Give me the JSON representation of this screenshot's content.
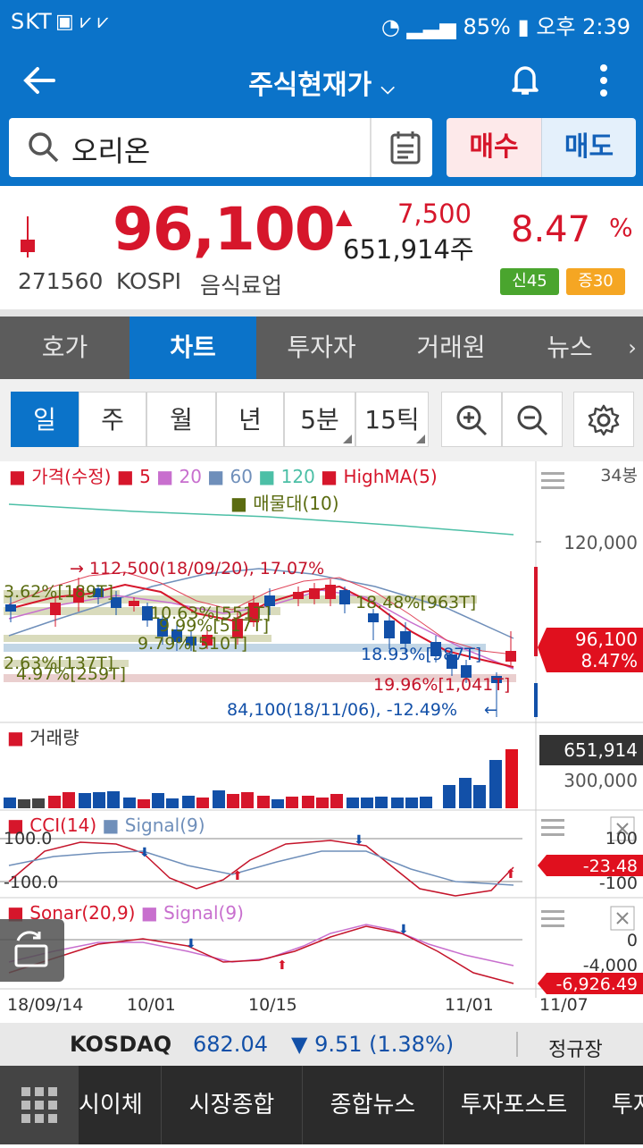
{
  "status_bar": {
    "carrier": "SKT",
    "battery": "85%",
    "time": "오후 2:39"
  },
  "app_bar": {
    "title": "주식현재가"
  },
  "search": {
    "value": "오리온"
  },
  "actions": {
    "buy": "매수",
    "sell": "매도"
  },
  "quote": {
    "price": "96,100",
    "change": "7,500",
    "volume": "651,914주",
    "change_pct": "8.47",
    "pct_sign": "%",
    "code": "271560",
    "market": "KOSPI",
    "sector": "음식료업",
    "badge_credit": "신45",
    "badge_margin": "증30"
  },
  "tabs": [
    "호가",
    "차트",
    "투자자",
    "거래원",
    "뉴스"
  ],
  "periods": [
    "일",
    "주",
    "월",
    "년",
    "5분",
    "15틱"
  ],
  "chart": {
    "legend_price": "가격(수정)",
    "legend_ma5": "5",
    "legend_ma20": "20",
    "legend_ma60": "60",
    "legend_ma120": "120",
    "legend_highma": "HighMA(5)",
    "legend_vp": "매물대(10)",
    "bars_count": "34봉",
    "y_top": "120,000",
    "price_tag": "96,100",
    "pct_tag": "8.47%",
    "high_annot": "→ 112,500(18/09/20), 17.07%",
    "low_annot": "84,100(18/11/06), -12.49%",
    "vp_labels": [
      "3.62%[189T]",
      "10.63%[551T]",
      "9.99%[517T]",
      "18.48%[963T]",
      "9.79%[510T]",
      "18.93%[987T]",
      "2.63%[137T]",
      "4.97%[259T]",
      "19.96%[1,041T]"
    ],
    "volume_title": "거래량",
    "volume_tag": "651,914",
    "volume_axis": "300,000",
    "cci_title": "CCI(14)",
    "cci_signal": "Signal(9)",
    "cci_top": "100.0",
    "cci_bottom": "-100.0",
    "cci_axis_top": "100",
    "cci_axis_bottom": "-100",
    "cci_tag": "-23.48",
    "sonar_title": "Sonar(20,9)",
    "sonar_signal": "Signal(9)",
    "sonar_axis_mid": "0",
    "sonar_axis_low": "-4,000",
    "sonar_tag": "-6,926.49",
    "x_labels": [
      "18/09/14",
      "10/01",
      "10/15",
      "11/01",
      "11/07"
    ]
  },
  "ticker": {
    "name": "KOSDAQ",
    "value": "682.04",
    "change": "▼ 9.51 (1.38%)",
    "session": "정규장"
  },
  "bottom_nav": [
    "시이체",
    "시장종합",
    "종합뉴스",
    "투자포스트",
    "투자"
  ],
  "colors": {
    "primary": "#0b73c9",
    "up": "#d6162b",
    "down": "#1250a8"
  }
}
